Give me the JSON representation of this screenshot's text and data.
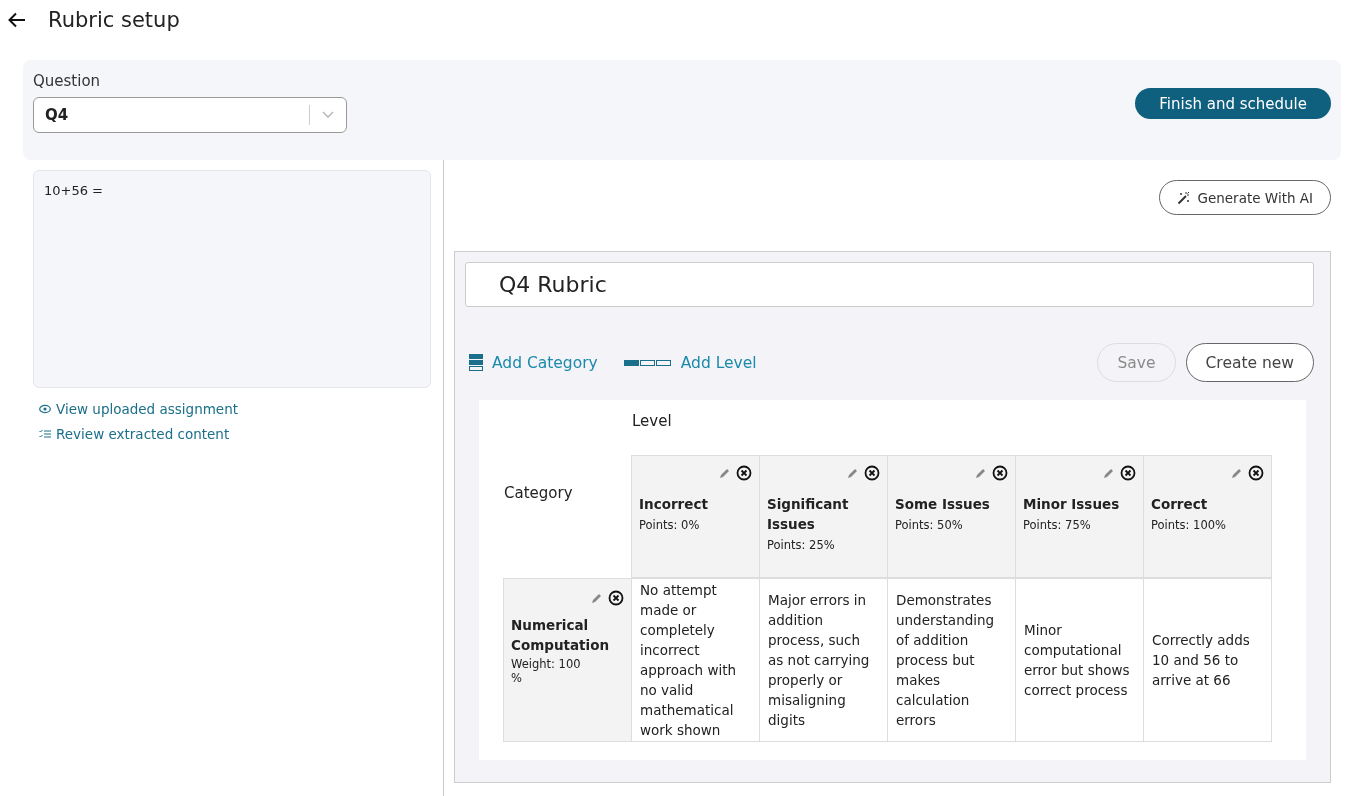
{
  "header": {
    "title": "Rubric setup"
  },
  "question_picker": {
    "label": "Question",
    "value": "Q4"
  },
  "finish_button": "Finish and schedule",
  "question_text": "10+56 =",
  "links": [
    {
      "kind": "view",
      "label": "View uploaded assignment"
    },
    {
      "kind": "review",
      "label": "Review extracted content"
    }
  ],
  "generate_button": "Generate With AI",
  "rubric": {
    "title": "Q4 Rubric",
    "add_category": "Add Category",
    "add_level": "Add Level",
    "save": {
      "label": "Save",
      "disabled": true
    },
    "create_new": "Create new",
    "level_heading": "Level",
    "category_heading": "Category",
    "levels": [
      {
        "name": "Incorrect",
        "points": "Points: 0%"
      },
      {
        "name": "Significant Issues",
        "points": "Points: 25%"
      },
      {
        "name": "Some Issues",
        "points": "Points: 50%"
      },
      {
        "name": "Minor Issues",
        "points": "Points: 75%"
      },
      {
        "name": "Correct",
        "points": "Points: 100%"
      }
    ],
    "categories": [
      {
        "name": "Numerical Computation",
        "weight": "Weight: 100 %",
        "descriptions": [
          "No attempt made or completely incorrect approach with no valid mathematical work shown",
          "Major errors in addition process, such as not carrying properly or misaligning digits",
          "Demonstrates understanding of addition process but makes calculation errors",
          "Minor computational error but shows correct process",
          "Correctly adds 10 and 56 to arrive at 66"
        ]
      }
    ]
  }
}
